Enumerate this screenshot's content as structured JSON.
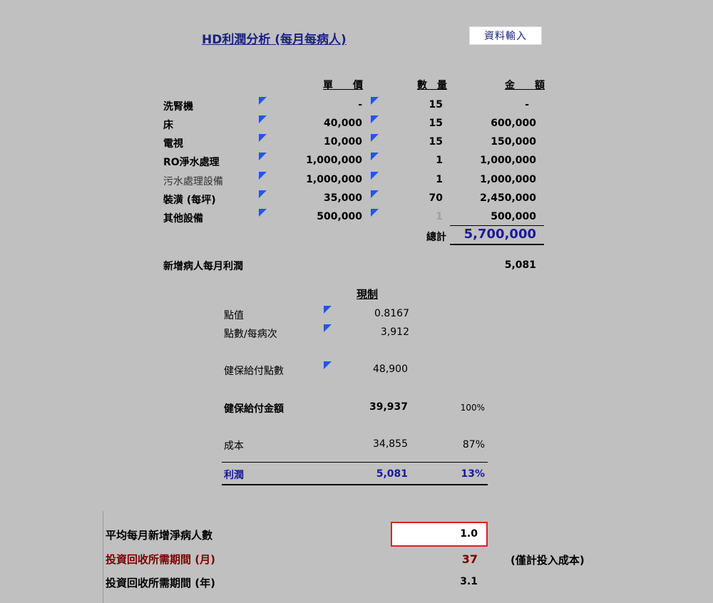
{
  "title": "HD利潤分析 (每月每病人)",
  "input_button": "資料輸入",
  "headers": {
    "unit_price": "單　　價",
    "quantity": "數　量",
    "amount": "金　　額"
  },
  "equipment": [
    {
      "name": "洗腎機",
      "price": "-",
      "qty": "15",
      "amount": "-"
    },
    {
      "name": "床",
      "price": "40,000",
      "qty": "15",
      "amount": "600,000"
    },
    {
      "name": "電視",
      "price": "10,000",
      "qty": "15",
      "amount": "150,000"
    },
    {
      "name": "RO淨水處理",
      "price": "1,000,000",
      "qty": "1",
      "amount": "1,000,000"
    },
    {
      "name": "污水處理設備",
      "price": "1,000,000",
      "qty": "1",
      "amount": "1,000,000"
    },
    {
      "name": "裝潢 (每坪)",
      "price": "35,000",
      "qty": "70",
      "amount": "2,450,000"
    },
    {
      "name": "其他設備",
      "price": "500,000",
      "qty": "1",
      "amount": "500,000"
    }
  ],
  "total": {
    "label": "總計",
    "value": "5,700,000"
  },
  "new_patient_profit": {
    "label": "新增病人每月利潤",
    "value": "5,081"
  },
  "current": {
    "heading": "現制",
    "point_value": {
      "label": "點值",
      "value": "0.8167"
    },
    "points_per_visit": {
      "label": "點數/每病次",
      "value": "3,912"
    },
    "nhi_points": {
      "label": "健保給付點數",
      "value": "48,900"
    },
    "nhi_amount": {
      "label": "健保給付金額",
      "value": "39,937",
      "pct": "100%"
    },
    "cost": {
      "label": "成本",
      "value": "34,855",
      "pct": "87%"
    },
    "profit": {
      "label": "利潤",
      "value": "5,081",
      "pct": "13%"
    }
  },
  "bottom": {
    "avg_new_patients": {
      "label": "平均每月新增淨病人數",
      "value": "1.0"
    },
    "payback_months": {
      "label": "投資回收所需期間 (月)",
      "value": "37",
      "note": "(僅計投入成本)"
    },
    "payback_years": {
      "label": "投資回收所需期間 (年)",
      "value": "3.1"
    }
  },
  "colors": {
    "background": "#c0c0c0",
    "accent_blue": "#1a1a99",
    "dark_red": "#7a0000",
    "input_border": "#e02020",
    "marker_blue": "#2255ee"
  }
}
